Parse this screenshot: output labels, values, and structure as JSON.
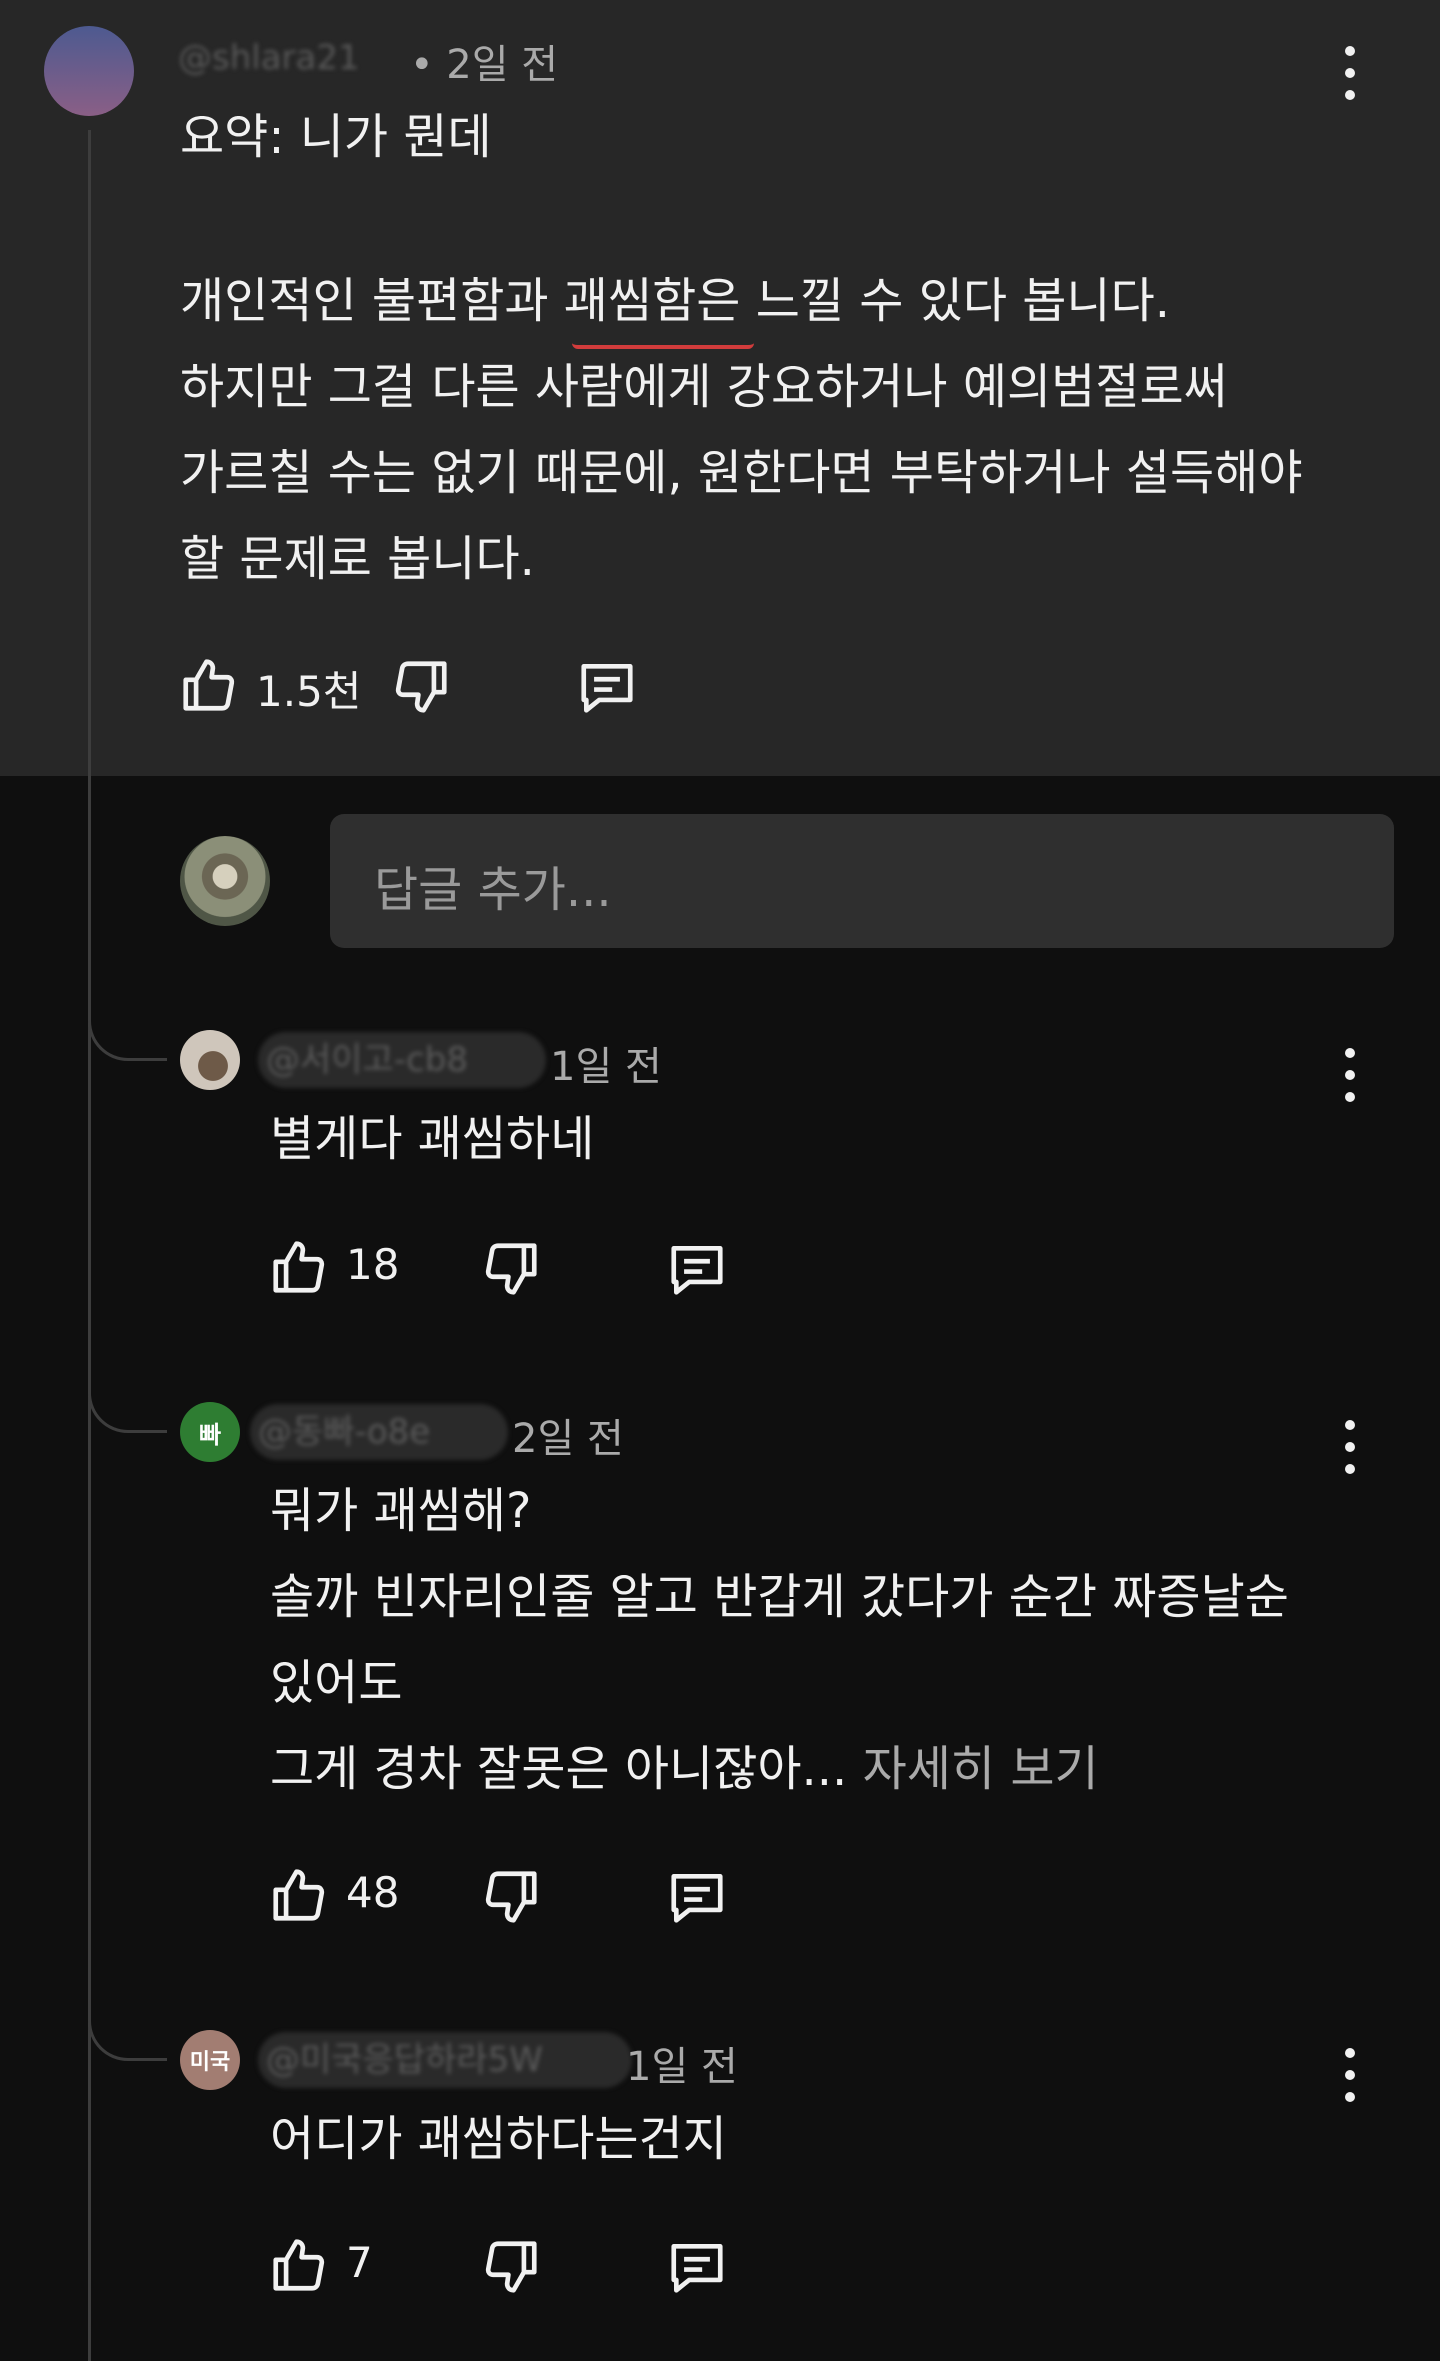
{
  "top_comment": {
    "author": "@shlara21",
    "time": "• 2일 전",
    "lines": [
      "요약: 니가 뭔데",
      "개인적인 불편함과 괘씸함은 느낄 수 있다 봅니다.",
      "하지만 그걸 다른 사람에게 강요하거나 예의범절로써",
      "가르칠 수는 없기 때문에, 원한다면 부탁하거나 설득해야",
      "할 문제로 봅니다."
    ],
    "likes": "1.5천"
  },
  "reply_box": {
    "placeholder": "답글 추가..."
  },
  "replies": [
    {
      "author": "@서이고-cb8",
      "time": "1일 전",
      "lines": [
        "별게다 괘씸하네"
      ],
      "likes": "18"
    },
    {
      "avatar_label": "빠",
      "author": "@동빠-o8e",
      "time": "2일 전",
      "lines": [
        "뭐가 괘씸해?",
        "솔까 빈자리인줄 알고 반갑게 갔다가 순간 짜증날순",
        "있어도",
        "그게 경차 잘못은 아니잖아..."
      ],
      "more": "자세히 보기",
      "likes": "48"
    },
    {
      "avatar_label": "미국",
      "author": "@미국응답하라5W",
      "time": "1일 전",
      "lines": [
        "어디가 괘씸하다는건지"
      ],
      "likes": "7"
    }
  ],
  "colors": {
    "panel": "#272727",
    "background": "#0f0f0f",
    "avatar_green": "#2e7d32",
    "avatar_rose": "#a27d72",
    "avatar_top": "#7a5a80"
  },
  "icons": [
    "like-icon",
    "dislike-icon",
    "reply-icon",
    "more-vert-icon"
  ]
}
